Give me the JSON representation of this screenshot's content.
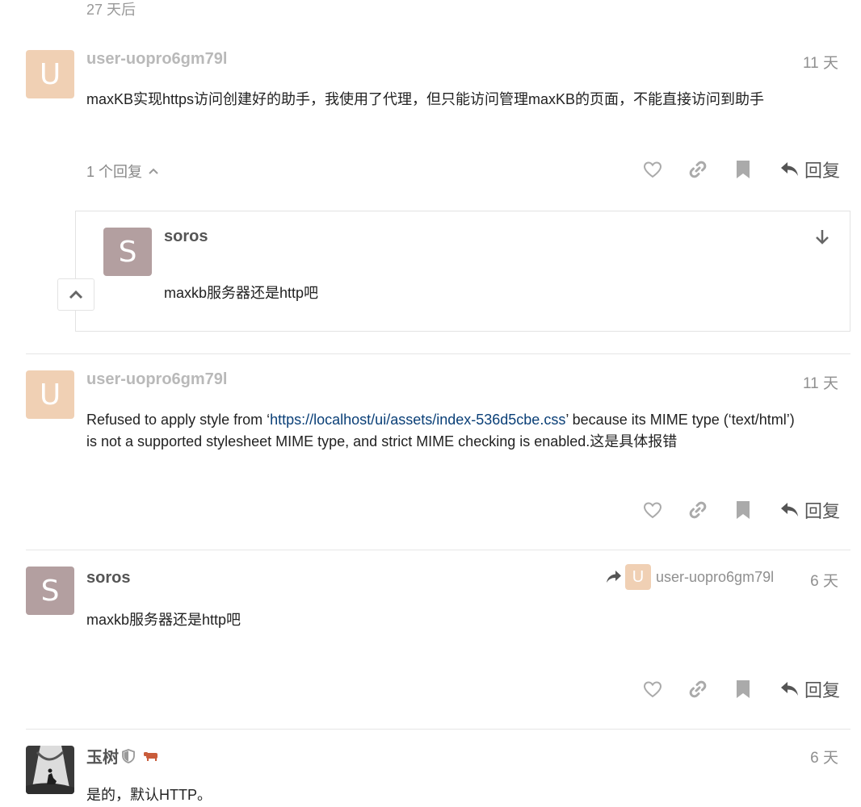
{
  "top": {
    "days_after": "27 天后"
  },
  "posts": [
    {
      "avatar_letter": "U",
      "username": "user-uopro6gm79l",
      "date": "11 天",
      "body": "maxKB实现https访问创建好的助手，我使用了代理，但只能访问管理maxKB的页面，不能直接访问到助手",
      "replies_toggle": "1 个回复",
      "reply_label": "回复"
    },
    {
      "avatar_letter": "U",
      "username": "user-uopro6gm79l",
      "date": "11 天",
      "body_pre": "Refused to apply style from ‘",
      "body_link": "https://localhost/ui/assets/index-536d5cbe.css",
      "body_post_line1": "’ because its MIME type (‘text/html’)",
      "body_line2": "is not a supported stylesheet MIME type, and strict MIME checking is enabled.这是具体报错",
      "reply_label": "回复"
    },
    {
      "avatar_letter": "S",
      "username": "soros",
      "reply_to_letter": "U",
      "reply_to_user": "user-uopro6gm79l",
      "date": "6 天",
      "body": "maxkb服务器还是http吧",
      "reply_label": "回复"
    },
    {
      "username": "玉树",
      "date": "6 天",
      "body": "是的，默认HTTP。"
    }
  ],
  "embedded_reply": {
    "avatar_letter": "S",
    "username": "soros",
    "body": "maxkb服务器还是http吧"
  },
  "colors": {
    "avatar_u": "#f0d0b4",
    "avatar_s": "#b39fa0",
    "link": "#0a3f77",
    "icon_gray": "#aaaaaa"
  }
}
